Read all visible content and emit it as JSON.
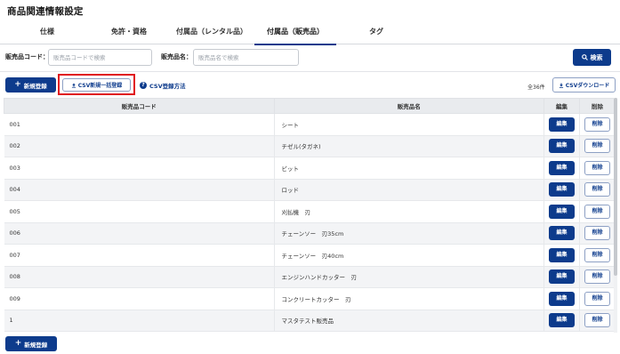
{
  "page": {
    "title": "商品関連情報設定"
  },
  "tabs": [
    {
      "label": "仕様",
      "active": false
    },
    {
      "label": "免許・資格",
      "active": false
    },
    {
      "label": "付属品（レンタル品）",
      "active": false
    },
    {
      "label": "付属品（販売品）",
      "active": true
    },
    {
      "label": "タグ",
      "active": false
    }
  ],
  "search": {
    "code_label": "販売品コード：",
    "code_placeholder": "販売品コードで検索",
    "name_label": "販売品名：",
    "name_placeholder": "販売品名で検索",
    "button_label": "検索"
  },
  "actions": {
    "new_label": "新規登録",
    "csv_bulk_label": "CSV新規一括登録",
    "csv_help_label": "CSV登録方法",
    "count_text": "全36件",
    "csv_download_label": "CSVダウンロード"
  },
  "table": {
    "headers": [
      "販売品コード",
      "販売品名",
      "編集",
      "削除"
    ],
    "edit_label": "編集",
    "delete_label": "削除",
    "rows": [
      {
        "code": "001",
        "name": "シート"
      },
      {
        "code": "002",
        "name": "チゼル(タガネ)"
      },
      {
        "code": "003",
        "name": "ビット"
      },
      {
        "code": "004",
        "name": "ロッド"
      },
      {
        "code": "005",
        "name": "刈払機　刃"
      },
      {
        "code": "006",
        "name": "チェーンソー　刃35cm"
      },
      {
        "code": "007",
        "name": "チェーンソー　刃40cm"
      },
      {
        "code": "008",
        "name": "エンジンハンドカッター　刃"
      },
      {
        "code": "009",
        "name": "コンクリートカッター　刃"
      },
      {
        "code": "1",
        "name": "マスタテスト販売品"
      }
    ]
  },
  "footer": {
    "new_label": "新規登録"
  },
  "colors": {
    "primary": "#0d3b8c",
    "highlight": "#e0141e",
    "header_bg": "#e9ebee"
  }
}
